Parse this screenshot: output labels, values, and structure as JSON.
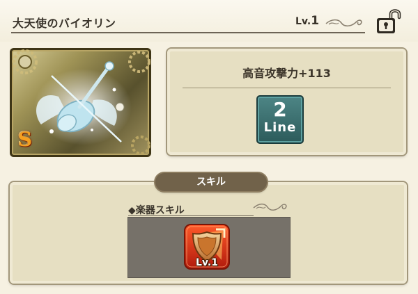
{
  "header": {
    "item_name": "大天使のバイオリン",
    "level_prefix": "Lv.",
    "level_value": "1"
  },
  "card": {
    "rarity": "S"
  },
  "stats": {
    "stat_text": "高音攻撃力+113",
    "line_number": "2",
    "line_label": "Line"
  },
  "skill": {
    "tab_label": "スキル",
    "section_label": "◆楽器スキル",
    "skill_level": "Lv.1"
  },
  "colors": {
    "background": "#f6f1e2",
    "panel": "#e6dfc2",
    "tab": "#71624a",
    "line_badge": "#2f5e5e",
    "skill_slot": "#767169",
    "rarity": "#f4a020"
  },
  "icons": {
    "lock": "unlocked-padlock-icon",
    "skill": "shield-skill-icon",
    "flourish": "scroll-flourish-icon"
  }
}
